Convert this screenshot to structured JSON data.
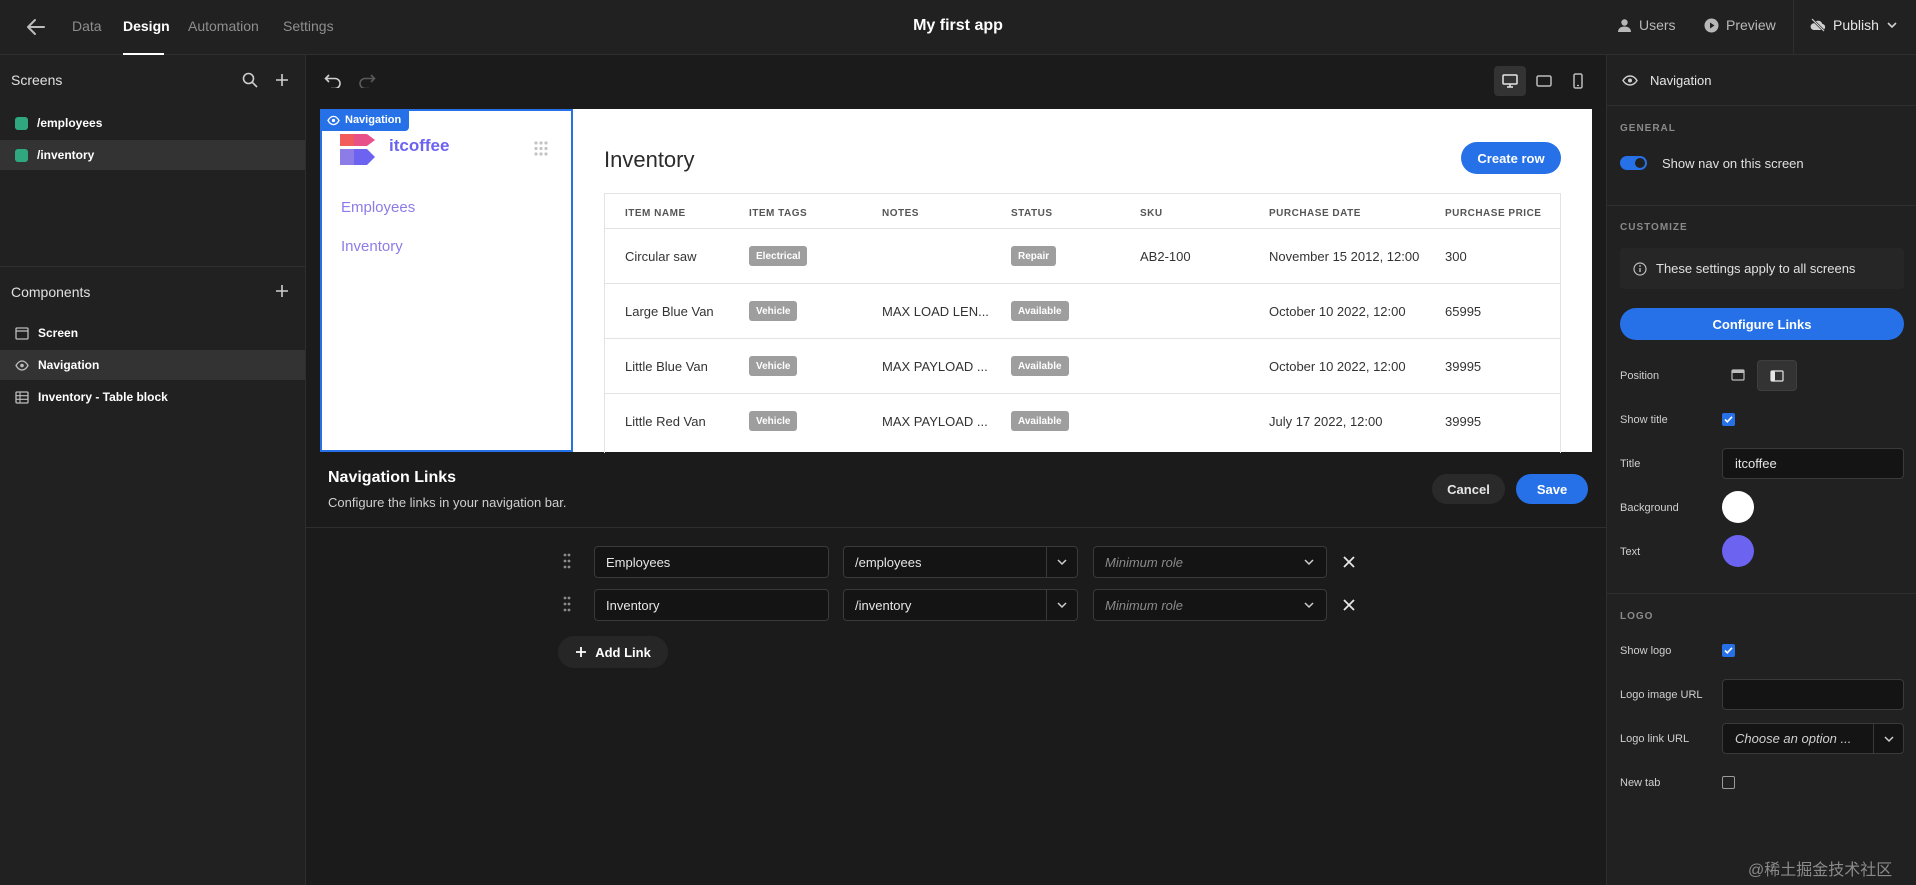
{
  "topbar": {
    "tabs": [
      "Data",
      "Design",
      "Automation",
      "Settings"
    ],
    "app_title": "My first app",
    "users": "Users",
    "preview": "Preview",
    "publish": "Publish"
  },
  "left": {
    "screens_title": "Screens",
    "screens": [
      "/employees",
      "/inventory"
    ],
    "components_title": "Components",
    "components": [
      "Screen",
      "Navigation",
      "Inventory - Table block"
    ]
  },
  "canvas": {
    "nav_badge": "Navigation",
    "brand": "itcoffee",
    "nav_links": [
      "Employees",
      "Inventory"
    ],
    "content_title": "Inventory",
    "create_row": "Create row",
    "table": {
      "headers": [
        "ITEM NAME",
        "ITEM TAGS",
        "NOTES",
        "STATUS",
        "SKU",
        "PURCHASE DATE",
        "PURCHASE PRICE"
      ],
      "rows": [
        {
          "name": "Circular saw",
          "tag": "Electrical",
          "notes": "",
          "status": "Repair",
          "sku": "AB2-100",
          "date": "November 15 2012, 12:00",
          "price": "300"
        },
        {
          "name": "Large Blue Van",
          "tag": "Vehicle",
          "notes": "MAX LOAD LEN...",
          "status": "Available",
          "sku": "",
          "date": "October 10 2022, 12:00",
          "price": "65995"
        },
        {
          "name": "Little Blue Van",
          "tag": "Vehicle",
          "notes": "MAX PAYLOAD ...",
          "status": "Available",
          "sku": "",
          "date": "October 10 2022, 12:00",
          "price": "39995"
        },
        {
          "name": "Little Red Van",
          "tag": "Vehicle",
          "notes": "MAX PAYLOAD ...",
          "status": "Available",
          "sku": "",
          "date": "July 17 2022, 12:00",
          "price": "39995"
        }
      ]
    }
  },
  "links_panel": {
    "title": "Navigation Links",
    "subtitle": "Configure the links in your navigation bar.",
    "cancel": "Cancel",
    "save": "Save",
    "links": [
      {
        "label": "Employees",
        "url": "/employees",
        "role_placeholder": "Minimum role"
      },
      {
        "label": "Inventory",
        "url": "/inventory",
        "role_placeholder": "Minimum role"
      }
    ],
    "add_link": "Add Link"
  },
  "right": {
    "header": "Navigation",
    "general": "GENERAL",
    "show_nav": "Show nav on this screen",
    "customize": "CUSTOMIZE",
    "info": "These settings apply to all screens",
    "configure_links": "Configure Links",
    "position": "Position",
    "show_title": "Show title",
    "title_label": "Title",
    "title_value": "itcoffee",
    "background": "Background",
    "text": "Text",
    "logo": "LOGO",
    "show_logo": "Show logo",
    "logo_image_url": "Logo image URL",
    "logo_link_url": "Logo link URL",
    "logo_link_placeholder": "Choose an option ...",
    "new_tab": "New tab",
    "colors": {
      "background": "#ffffff",
      "text": "#6c63f0",
      "accent": "#2671e8"
    }
  },
  "watermark": "@稀土掘金技术社区"
}
